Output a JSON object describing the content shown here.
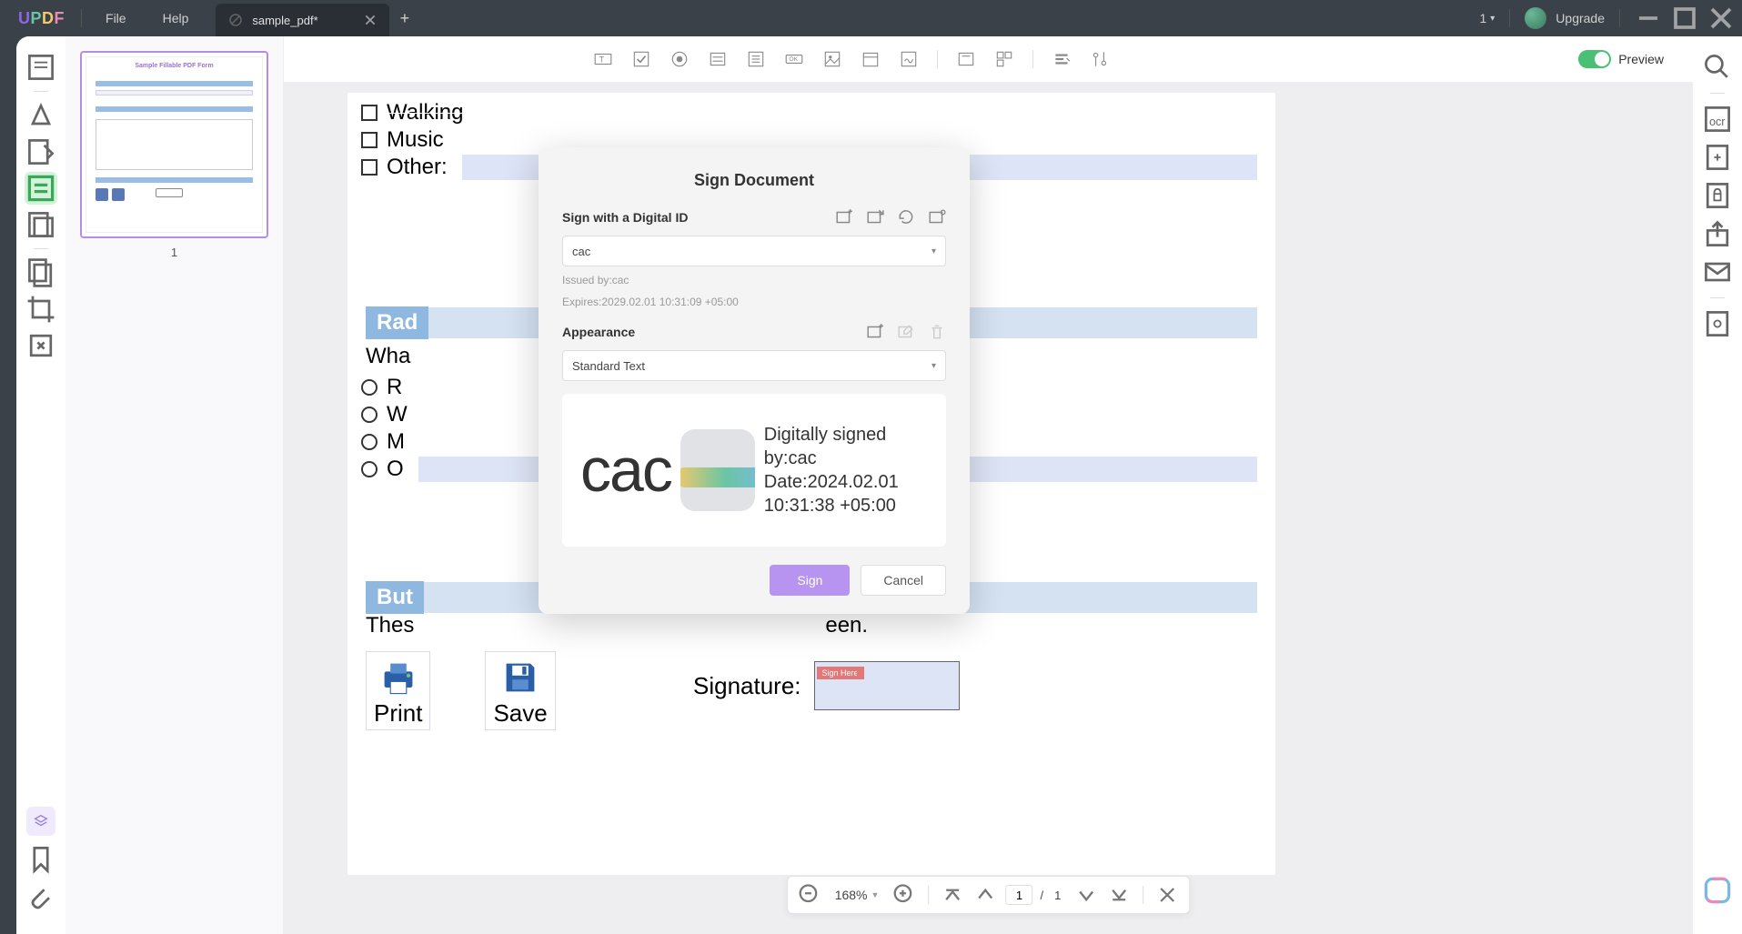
{
  "titlebar": {
    "logo_u": "U",
    "logo_p": "P",
    "logo_d": "D",
    "logo_f": "F",
    "menu_file": "File",
    "menu_help": "Help",
    "tab_title": "sample_pdf*",
    "counter": "1",
    "upgrade": "Upgrade"
  },
  "form_toolbar": {
    "preview": "Preview"
  },
  "page": {
    "chk_walking": "Walking",
    "chk_music": "Music",
    "chk_other": "Other:",
    "radio_hdr": "Rad",
    "radio_q": "Wha",
    "r1": "R",
    "r2": "W",
    "r3": "M",
    "r4": "O",
    "btn_hdr": "But",
    "btn_desc": "Thes",
    "btn_desc_after": "een.",
    "print": "Print",
    "save": "Save",
    "signature": "Signature:",
    "sign_here": "Sign Here"
  },
  "dialog": {
    "title": "Sign Document",
    "section_id": "Sign with a Digital ID",
    "id_value": "cac",
    "issued": "Issued by:cac",
    "expires": "Expires:2029.02.01 10:31:09 +05:00",
    "appearance": "Appearance",
    "appearance_value": "Standard Text",
    "preview_name": "cac",
    "preview_signed": "Digitally signed by:cac",
    "preview_date": "Date:2024.02.01",
    "preview_time": "10:31:38 +05:00",
    "sign": "Sign",
    "cancel": "Cancel"
  },
  "thumb": {
    "num": "1"
  },
  "page_nav": {
    "zoom": "168%",
    "page": "1",
    "sep": "/",
    "total": "1"
  }
}
